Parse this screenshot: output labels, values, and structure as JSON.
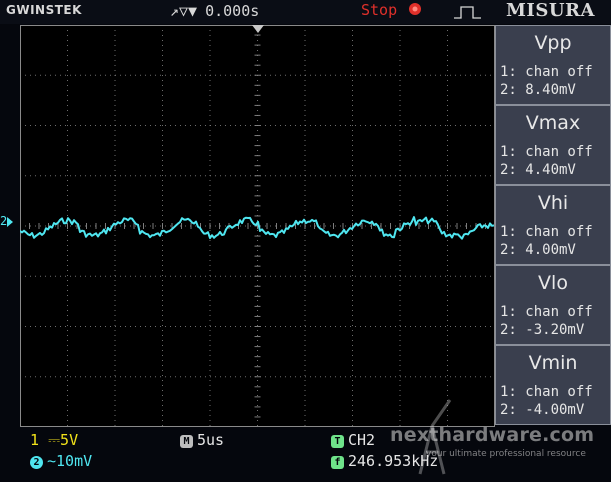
{
  "header": {
    "brand": "GWINSTEK",
    "trigger_symbols": "↗▽▼",
    "time_offset": "0.000s",
    "run_state": "Stop"
  },
  "misura_label": "MISURA",
  "measurements": [
    {
      "title": "Vpp",
      "ch1": "1: chan off",
      "ch2": "2: 8.40mV"
    },
    {
      "title": "Vmax",
      "ch1": "1: chan off",
      "ch2": "2: 4.40mV"
    },
    {
      "title": "Vhi",
      "ch1": "1: chan off",
      "ch2": "2: 4.00mV"
    },
    {
      "title": "Vlo",
      "ch1": "1: chan off",
      "ch2": "2: -3.20mV"
    },
    {
      "title": "Vmin",
      "ch1": "1: chan off",
      "ch2": "2: -4.00mV"
    }
  ],
  "status": {
    "ch1_num": "1",
    "ch1_scale": "⎓5V",
    "ch2_num": "2",
    "ch2_scale": "∼10mV",
    "timebase_badge": "M",
    "timebase": "5us",
    "trigger_badge": "T",
    "trigger_channel": "CH2",
    "freq_badge": "f",
    "frequency": "246.953kHz"
  },
  "channel_marker": "2",
  "watermark": {
    "site": "nexthardware.com",
    "tagline": "your ultimate professional resource"
  },
  "colors": {
    "ch1": "#f2e21a",
    "ch2": "#4fe6f0",
    "stop": "#e0302a",
    "panel": "#3a3f4e"
  }
}
